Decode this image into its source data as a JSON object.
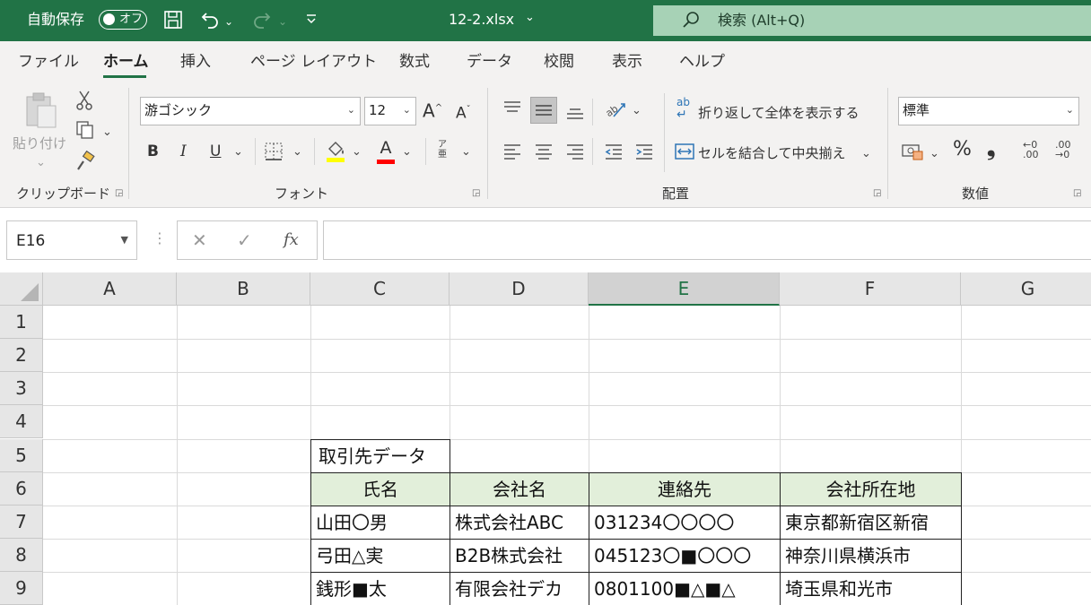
{
  "titlebar": {
    "autosave_label": "自動保存",
    "autosave_state": "オフ",
    "filename": "12-2.xlsx",
    "filename_caret": "⌄",
    "search_placeholder": "検索 (Alt+Q)",
    "icons": [
      "save-icon",
      "undo-icon",
      "redo-icon",
      "customize-qat-icon",
      "search-icon"
    ]
  },
  "ribbon_tabs": [
    "ファイル",
    "ホーム",
    "挿入",
    "ページ レイアウト",
    "数式",
    "データ",
    "校閲",
    "表示",
    "ヘルプ"
  ],
  "active_tab": "ホーム",
  "clipboard": {
    "paste_label": "貼り付け",
    "group_label": "クリップボード"
  },
  "font": {
    "font_name": "游ゴシック",
    "font_size": "12",
    "bold": "B",
    "italic": "I",
    "underline": "U",
    "grow": "A",
    "shrink": "A",
    "color_letter": "A",
    "phonetic_top": "ア",
    "phonetic_bottom": "亜",
    "group_label": "フォント",
    "fill_color": "#ffff00",
    "font_color": "#ff0000"
  },
  "alignment": {
    "wrap_text_label": "折り返して全体を表示する",
    "merge_center_label": "セルを結合して中央揃え",
    "wrap_icon_text": "ab",
    "group_label": "配置"
  },
  "number": {
    "format": "標準",
    "percent": "%",
    "comma": "❟",
    "inc_decimal": "←0 .00",
    "dec_decimal": ".00 →0",
    "group_label": "数値"
  },
  "formula_bar": {
    "name_box": "E16",
    "cancel": "✕",
    "enter": "✓",
    "fx": "fx",
    "formula": ""
  },
  "columns": [
    "A",
    "B",
    "C",
    "D",
    "E",
    "F",
    "G"
  ],
  "selected_column": "E",
  "rows": [
    "1",
    "2",
    "3",
    "4",
    "5",
    "6",
    "7",
    "8",
    "9"
  ],
  "table": {
    "title": "取引先データ",
    "headers": [
      "氏名",
      "会社名",
      "連絡先",
      "会社所在地"
    ],
    "rows": [
      [
        "山田〇男",
        "株式会社ABC",
        "031234〇〇〇〇",
        "東京都新宿区新宿"
      ],
      [
        "弓田△実",
        "B2B株式会社",
        "045123〇■〇〇〇",
        "神奈川県横浜市"
      ],
      [
        "銭形■太",
        "有限会社デカ",
        "0801100■△■△",
        "埼玉県和光市"
      ]
    ]
  },
  "colors": {
    "accent": "#217346",
    "search_bg": "#a7d2b6",
    "header_fill": "#e2efda"
  }
}
